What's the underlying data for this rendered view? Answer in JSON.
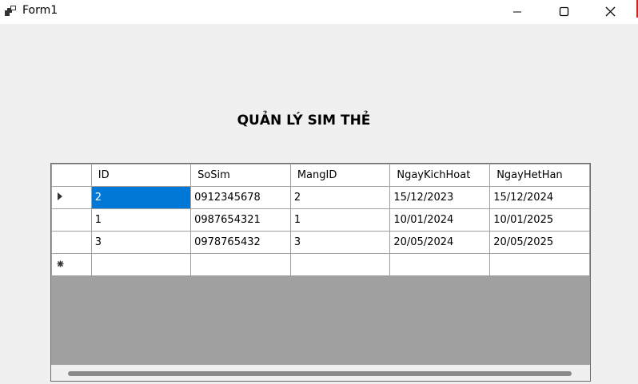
{
  "window": {
    "title": "Form1",
    "app_icon": "app-window-icon",
    "controls": {
      "minimize": "minimize-icon",
      "maximize": "maximize-icon",
      "close": "close-icon"
    }
  },
  "form": {
    "heading": "QUẢN LÝ SIM THẺ"
  },
  "grid": {
    "columns": [
      "ID",
      "SoSim",
      "MangID",
      "NgayKichHoat",
      "NgayHetHan"
    ],
    "rows": [
      {
        "ID": "2",
        "SoSim": "0912345678",
        "MangID": "2",
        "NgayKichHoat": "15/12/2023",
        "NgayHetHan": "15/12/2024",
        "current": true,
        "selected_cell": "ID"
      },
      {
        "ID": "1",
        "SoSim": "0987654321",
        "MangID": "1",
        "NgayKichHoat": "10/01/2024",
        "NgayHetHan": "10/01/2025"
      },
      {
        "ID": "3",
        "SoSim": "0978765432",
        "MangID": "3",
        "NgayKichHoat": "20/05/2024",
        "NgayHetHan": "20/05/2025"
      }
    ],
    "new_row_marker": "new-row-asterisk-icon",
    "current_row_marker": "current-row-arrow-icon",
    "colors": {
      "selection": "#0078d7",
      "empty_area": "#a0a0a0"
    }
  }
}
